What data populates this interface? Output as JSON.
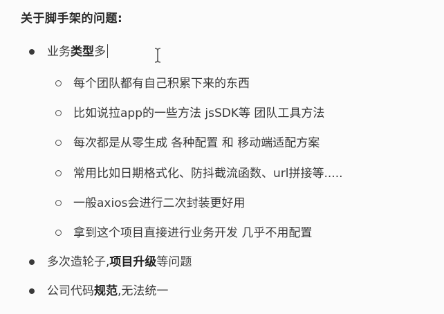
{
  "heading": "关于脚手架的问题:",
  "items": [
    {
      "pre": "业务",
      "bold": "类型",
      "post": "多"
    },
    {
      "text": "每个团队都有自己积累下来的东西"
    },
    {
      "text": "比如说拉app的一些方法 jsSDK等 团队工具方法"
    },
    {
      "text": "每次都是从零生成 各种配置 和 移动端适配方案"
    },
    {
      "text": "常用比如日期格式化、防抖截流函数、url拼接等....."
    },
    {
      "text": "一般axios会进行二次封装更好用"
    },
    {
      "text": "拿到这个项目直接进行业务开发 几乎不用配置"
    },
    {
      "pre": "多次造轮子,",
      "bold": "项目升级",
      "post": "等问题"
    },
    {
      "pre": "公司代码",
      "bold": "规范",
      "post": ",无法统一"
    }
  ]
}
